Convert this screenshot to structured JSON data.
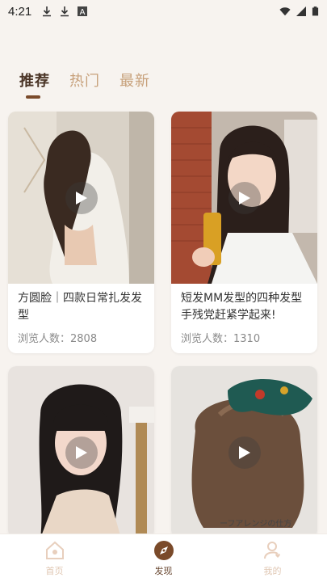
{
  "status": {
    "time": "4:21",
    "left_icons": [
      "download-icon",
      "download-icon",
      "text-a-icon"
    ],
    "right_icons": [
      "wifi-icon",
      "signal-icon",
      "battery-icon"
    ]
  },
  "tabs": [
    {
      "label": "推荐",
      "active": true
    },
    {
      "label": "热门",
      "active": false
    },
    {
      "label": "最新",
      "active": false
    }
  ],
  "cards": [
    {
      "title": "方圆脸｜四款日常扎发发型",
      "views": "浏览人数：2808"
    },
    {
      "title": "短发MM发型的四种发型手残党赶紧学起来!",
      "views": "浏览人数：1310"
    },
    {
      "title": "",
      "views": ""
    },
    {
      "title": "",
      "views": ""
    }
  ],
  "bottom_nav": [
    {
      "label": "首页",
      "icon": "home-icon",
      "active": false
    },
    {
      "label": "发现",
      "icon": "compass-icon",
      "active": true
    },
    {
      "label": "我的",
      "icon": "profile-icon",
      "active": false
    }
  ],
  "colors": {
    "background": "#f7f3ef",
    "tab_active": "#4a3426",
    "tab_inactive": "#c7a07a",
    "nav_active": "#6b4a34",
    "nav_inactive": "#e0c7b3"
  }
}
